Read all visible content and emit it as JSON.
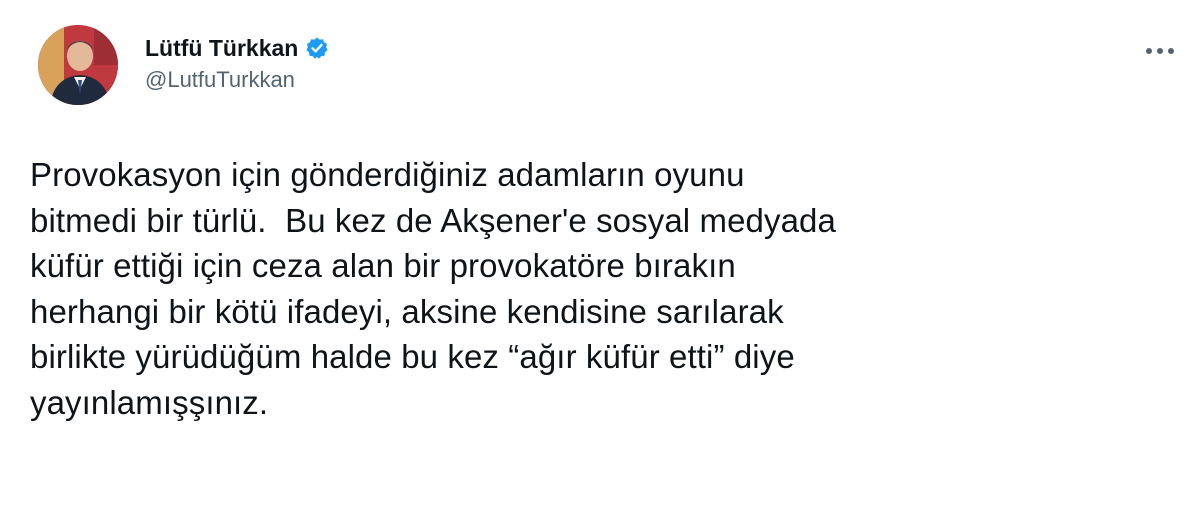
{
  "author": {
    "display_name": "Lütfü Türkkan",
    "handle": "@LutfuTurkkan",
    "verified": true
  },
  "icons": {
    "verified": "verified-badge-icon",
    "more": "more-options-icon",
    "avatar": "profile-photo"
  },
  "colors": {
    "verified_badge": "#1d9bf0",
    "handle_text": "#536471",
    "body_text": "#0f1419"
  },
  "tweet": {
    "lines": [
      "Provokasyon için gönderdiğiniz adamların oyunu",
      "bitmedi bir türlü.  Bu kez de Akşener'e sosyal medyada",
      "küfür ettiği için ceza alan bir provokatöre bırakın",
      "herhangi bir kötü ifadeyi, aksine kendisine sarılarak",
      "birlikte yürüdüğüm halde bu kez “ağır küfür etti” diye",
      "yayınlamışşınız."
    ]
  }
}
